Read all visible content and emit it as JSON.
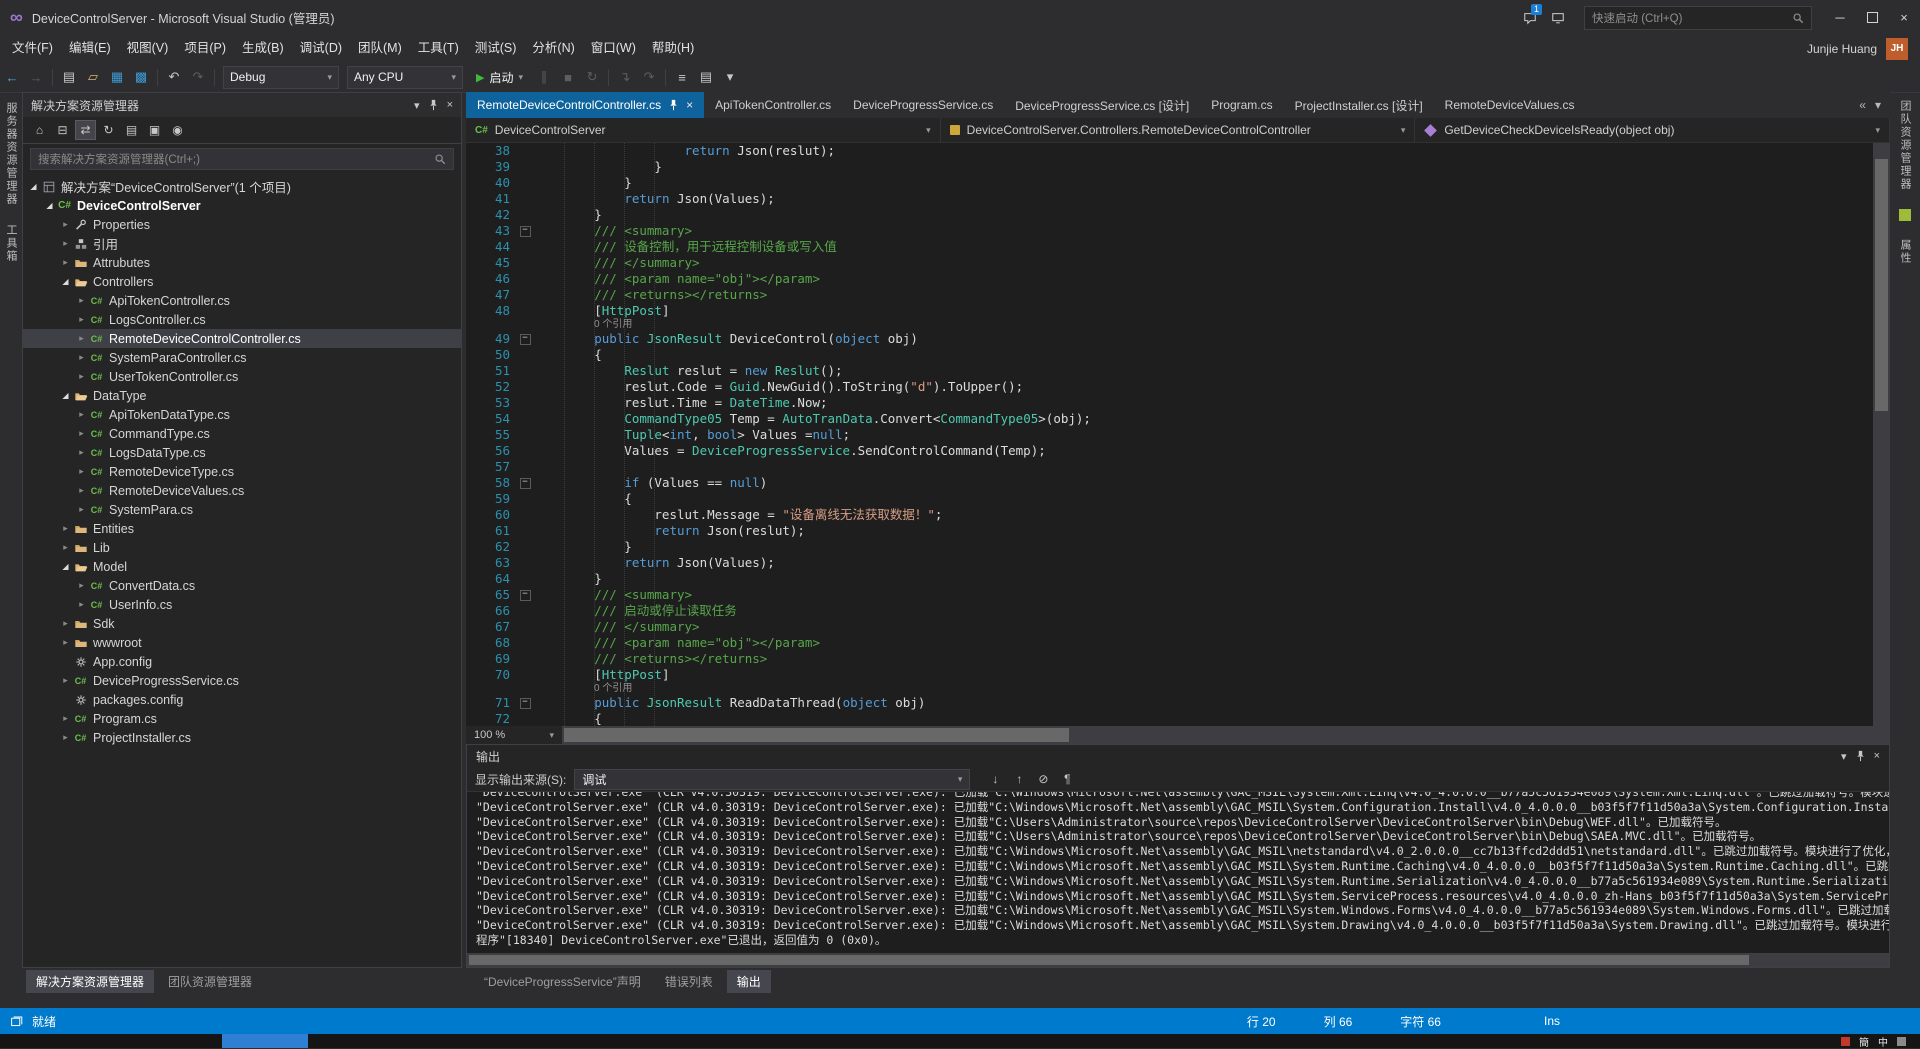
{
  "window": {
    "logo": "∞",
    "title": "DeviceControlServer - Microsoft Visual Studio (管理员)",
    "quick_launch_placeholder": "快速启动 (Ctrl+Q)",
    "feedback_badge": "1",
    "user_name": "Junjie Huang",
    "user_initials": "JH"
  },
  "menu": {
    "items": [
      "文件(F)",
      "编辑(E)",
      "视图(V)",
      "项目(P)",
      "生成(B)",
      "调试(D)",
      "团队(M)",
      "工具(T)",
      "测试(S)",
      "分析(N)",
      "窗口(W)",
      "帮助(H)"
    ]
  },
  "toolbar": {
    "config": "Debug",
    "platform": "Any CPU",
    "start_label": "启动",
    "left_icons": [
      {
        "n": "navigate-backward-icon",
        "g": "←",
        "c": "#4ea6ea"
      },
      {
        "n": "navigate-forward-icon",
        "g": "→",
        "d": 1
      },
      {
        "sep": 1
      },
      {
        "n": "new-file-icon",
        "g": "▤"
      },
      {
        "n": "open-file-icon",
        "g": "▱",
        "c": "#dcb67a"
      },
      {
        "n": "save-icon",
        "g": "▦",
        "c": "#3b99d4"
      },
      {
        "n": "save-all-icon",
        "g": "▩",
        "c": "#3b99d4"
      },
      {
        "sep": 1
      },
      {
        "n": "undo-icon",
        "g": "↶"
      },
      {
        "n": "redo-icon",
        "g": "↷",
        "d": 1
      },
      {
        "sep": 1
      }
    ],
    "right_icons": [
      {
        "n": "break-all-icon",
        "g": "∥",
        "d": 1
      },
      {
        "n": "stop-debugging-icon",
        "g": "■",
        "d": 1
      },
      {
        "n": "restart-icon",
        "g": "↻",
        "d": 1
      },
      {
        "sep": 1
      },
      {
        "n": "step-into-icon",
        "g": "↴",
        "d": 1
      },
      {
        "n": "step-over-icon",
        "g": "↷",
        "d": 1
      },
      {
        "sep": 1
      },
      {
        "n": "find-in-files-icon",
        "g": "≡"
      },
      {
        "n": "comment-icon",
        "g": "▤"
      },
      {
        "n": "toolbar-options-icon",
        "g": "▾"
      }
    ]
  },
  "strips": {
    "left": [
      "服务器资源管理器",
      "工具箱"
    ],
    "right": [
      "团队资源管理器",
      "属性"
    ]
  },
  "solution_explorer": {
    "title": "解决方案资源管理器",
    "search_placeholder": "搜索解决方案资源管理器(Ctrl+;)",
    "header_icons": [
      {
        "n": "window-position-icon",
        "g": "▾"
      },
      {
        "n": "pin-icon",
        "g": "@pin"
      },
      {
        "n": "close-icon",
        "g": "×"
      }
    ],
    "toolbar_icons": [
      {
        "n": "home-icon",
        "g": "⌂"
      },
      {
        "n": "collapse-all-icon",
        "g": "⊟"
      },
      {
        "n": "sync-with-active-document-icon",
        "g": "⇄",
        "pressed": 1
      },
      {
        "n": "refresh-icon",
        "g": "↻"
      },
      {
        "n": "show-all-files-icon",
        "g": "▤"
      },
      {
        "n": "properties-icon",
        "g": "▣"
      },
      {
        "n": "preview-selected-items-icon",
        "g": "◉"
      }
    ],
    "tree": [
      {
        "d": 0,
        "a": 2,
        "i": "sol",
        "t": "解决方案“DeviceControlServer”(1 个项目)"
      },
      {
        "d": 1,
        "a": 2,
        "i": "proj",
        "t": "DeviceControlServer",
        "b": 1
      },
      {
        "d": 2,
        "a": 1,
        "i": "props",
        "t": "Properties"
      },
      {
        "d": 2,
        "a": 1,
        "i": "refs",
        "t": "引用"
      },
      {
        "d": 2,
        "a": 1,
        "i": "folder",
        "t": "Attrubutes"
      },
      {
        "d": 2,
        "a": 2,
        "i": "folderOpen",
        "t": "Controllers"
      },
      {
        "d": 3,
        "a": 1,
        "i": "cs",
        "t": "ApiTokenController.cs"
      },
      {
        "d": 3,
        "a": 1,
        "i": "cs",
        "t": "LogsController.cs"
      },
      {
        "d": 3,
        "a": 1,
        "i": "cs",
        "t": "RemoteDeviceControlController.cs",
        "sel": 1
      },
      {
        "d": 3,
        "a": 1,
        "i": "cs",
        "t": "SystemParaController.cs"
      },
      {
        "d": 3,
        "a": 1,
        "i": "cs",
        "t": "UserTokenController.cs"
      },
      {
        "d": 2,
        "a": 2,
        "i": "folderOpen",
        "t": "DataType"
      },
      {
        "d": 3,
        "a": 1,
        "i": "cs",
        "t": "ApiTokenDataType.cs"
      },
      {
        "d": 3,
        "a": 1,
        "i": "cs",
        "t": "CommandType.cs"
      },
      {
        "d": 3,
        "a": 1,
        "i": "cs",
        "t": "LogsDataType.cs"
      },
      {
        "d": 3,
        "a": 1,
        "i": "cs",
        "t": "RemoteDeviceType.cs"
      },
      {
        "d": 3,
        "a": 1,
        "i": "cs",
        "t": "RemoteDeviceValues.cs"
      },
      {
        "d": 3,
        "a": 1,
        "i": "cs",
        "t": "SystemPara.cs"
      },
      {
        "d": 2,
        "a": 1,
        "i": "folder",
        "t": "Entities"
      },
      {
        "d": 2,
        "a": 1,
        "i": "folder",
        "t": "Lib"
      },
      {
        "d": 2,
        "a": 2,
        "i": "folderOpen",
        "t": "Model"
      },
      {
        "d": 3,
        "a": 1,
        "i": "cs",
        "t": "ConvertData.cs"
      },
      {
        "d": 3,
        "a": 1,
        "i": "cs",
        "t": "UserInfo.cs"
      },
      {
        "d": 2,
        "a": 1,
        "i": "folder",
        "t": "Sdk"
      },
      {
        "d": 2,
        "a": 1,
        "i": "folder",
        "t": "wwwroot"
      },
      {
        "d": 2,
        "a": 0,
        "i": "cfg",
        "t": "App.config"
      },
      {
        "d": 2,
        "a": 1,
        "i": "cs",
        "t": "DeviceProgressService.cs"
      },
      {
        "d": 2,
        "a": 0,
        "i": "cfg",
        "t": "packages.config"
      },
      {
        "d": 2,
        "a": 1,
        "i": "cs",
        "t": "Program.cs"
      },
      {
        "d": 2,
        "a": 1,
        "i": "cs",
        "t": "ProjectInstaller.cs"
      }
    ]
  },
  "editor": {
    "tabs": [
      {
        "t": "RemoteDeviceControlController.cs",
        "active": true
      },
      {
        "t": "ApiTokenController.cs"
      },
      {
        "t": "DeviceProgressService.cs"
      },
      {
        "t": "DeviceProgressService.cs [设计]"
      },
      {
        "t": "Program.cs"
      },
      {
        "t": "ProjectInstaller.cs [设计]"
      },
      {
        "t": "RemoteDeviceValues.cs"
      }
    ],
    "breadcrumb": [
      {
        "t": "DeviceControlServer",
        "icon": "project"
      },
      {
        "t": "DeviceControlServer.Controllers.RemoteDeviceControlController",
        "icon": "class"
      },
      {
        "t": "GetDeviceCheckDeviceIsReady(object obj)",
        "icon": "method"
      }
    ],
    "zoom": "100 %",
    "code": [
      {
        "n": 38,
        "g": [
          [
            "p",
            "                    "
          ],
          [
            "k",
            "return"
          ],
          [
            "p",
            " Json(reslut);"
          ]
        ]
      },
      {
        "n": 39,
        "g": [
          [
            "p",
            "                }"
          ]
        ]
      },
      {
        "n": 40,
        "g": [
          [
            "p",
            "            }"
          ]
        ]
      },
      {
        "n": 41,
        "g": [
          [
            "p",
            "            "
          ],
          [
            "k",
            "return"
          ],
          [
            "p",
            " Json(Values);"
          ]
        ]
      },
      {
        "n": 42,
        "g": [
          [
            "p",
            "        }"
          ]
        ]
      },
      {
        "n": 43,
        "f": 1,
        "g": [
          [
            "c",
            "        /// <summary>"
          ]
        ]
      },
      {
        "n": 44,
        "g": [
          [
            "c",
            "        /// 设备控制，用于远程控制设备或写入值"
          ]
        ]
      },
      {
        "n": 45,
        "g": [
          [
            "c",
            "        /// </summary>"
          ]
        ]
      },
      {
        "n": 46,
        "g": [
          [
            "c",
            "        /// <param name=\"obj\"></param>"
          ]
        ]
      },
      {
        "n": 47,
        "g": [
          [
            "c",
            "        /// <returns></returns>"
          ]
        ]
      },
      {
        "n": 48,
        "g": [
          [
            "p",
            "        ["
          ],
          [
            "t",
            "HttpPost"
          ],
          [
            "p",
            "]"
          ]
        ]
      },
      {
        "l": "0 个引用"
      },
      {
        "n": 49,
        "f": 1,
        "g": [
          [
            "p",
            "        "
          ],
          [
            "k",
            "public"
          ],
          [
            "p",
            " "
          ],
          [
            "t",
            "JsonResult"
          ],
          [
            "p",
            " DeviceControl("
          ],
          [
            "k",
            "object"
          ],
          [
            "p",
            " obj)"
          ]
        ]
      },
      {
        "n": 50,
        "g": [
          [
            "p",
            "        {"
          ]
        ]
      },
      {
        "n": 51,
        "g": [
          [
            "p",
            "            "
          ],
          [
            "t",
            "Reslut"
          ],
          [
            "p",
            " reslut = "
          ],
          [
            "k",
            "new"
          ],
          [
            "p",
            " "
          ],
          [
            "t",
            "Reslut"
          ],
          [
            "p",
            "();"
          ]
        ]
      },
      {
        "n": 52,
        "g": [
          [
            "p",
            "            reslut.Code = "
          ],
          [
            "t",
            "Guid"
          ],
          [
            "p",
            ".NewGuid().ToString("
          ],
          [
            "s",
            "\"d\""
          ],
          [
            "p",
            ").ToUpper();"
          ]
        ]
      },
      {
        "n": 53,
        "g": [
          [
            "p",
            "            reslut.Time = "
          ],
          [
            "t",
            "DateTime"
          ],
          [
            "p",
            ".Now;"
          ]
        ]
      },
      {
        "n": 54,
        "g": [
          [
            "p",
            "            "
          ],
          [
            "t",
            "CommandType05"
          ],
          [
            "p",
            " Temp = "
          ],
          [
            "t",
            "AutoTranData"
          ],
          [
            "p",
            ".Convert<"
          ],
          [
            "t",
            "CommandType05"
          ],
          [
            "p",
            ">(obj);"
          ]
        ]
      },
      {
        "n": 55,
        "g": [
          [
            "p",
            "            "
          ],
          [
            "t",
            "Tuple"
          ],
          [
            "p",
            "<"
          ],
          [
            "k",
            "int"
          ],
          [
            "p",
            ", "
          ],
          [
            "k",
            "bool"
          ],
          [
            "p",
            "> Values ="
          ],
          [
            "k",
            "null"
          ],
          [
            "p",
            ";"
          ]
        ]
      },
      {
        "n": 56,
        "g": [
          [
            "p",
            "            Values = "
          ],
          [
            "t",
            "DeviceProgressService"
          ],
          [
            "p",
            ".SendControlCommand(Temp);"
          ]
        ]
      },
      {
        "n": 57,
        "g": []
      },
      {
        "n": 58,
        "f": 1,
        "g": [
          [
            "p",
            "            "
          ],
          [
            "k",
            "if"
          ],
          [
            "p",
            " (Values == "
          ],
          [
            "k",
            "null"
          ],
          [
            "p",
            ")"
          ]
        ]
      },
      {
        "n": 59,
        "g": [
          [
            "p",
            "            {"
          ]
        ]
      },
      {
        "n": 60,
        "g": [
          [
            "p",
            "                reslut.Message = "
          ],
          [
            "s",
            "\"设备离线无法获取数据！\""
          ],
          [
            "p",
            ";"
          ]
        ]
      },
      {
        "n": 61,
        "g": [
          [
            "p",
            "                "
          ],
          [
            "k",
            "return"
          ],
          [
            "p",
            " Json(reslut);"
          ]
        ]
      },
      {
        "n": 62,
        "g": [
          [
            "p",
            "            }"
          ]
        ]
      },
      {
        "n": 63,
        "g": [
          [
            "p",
            "            "
          ],
          [
            "k",
            "return"
          ],
          [
            "p",
            " Json(Values);"
          ]
        ]
      },
      {
        "n": 64,
        "g": [
          [
            "p",
            "        }"
          ]
        ]
      },
      {
        "n": 65,
        "f": 1,
        "g": [
          [
            "c",
            "        /// <summary>"
          ]
        ]
      },
      {
        "n": 66,
        "g": [
          [
            "c",
            "        /// 启动或停止读取任务"
          ]
        ]
      },
      {
        "n": 67,
        "g": [
          [
            "c",
            "        /// </summary>"
          ]
        ]
      },
      {
        "n": 68,
        "g": [
          [
            "c",
            "        /// <param name=\"obj\"></param>"
          ]
        ]
      },
      {
        "n": 69,
        "g": [
          [
            "c",
            "        /// <returns></returns>"
          ]
        ]
      },
      {
        "n": 70,
        "g": [
          [
            "p",
            "        ["
          ],
          [
            "t",
            "HttpPost"
          ],
          [
            "p",
            "]"
          ]
        ]
      },
      {
        "l": "0 个引用"
      },
      {
        "n": 71,
        "f": 1,
        "g": [
          [
            "p",
            "        "
          ],
          [
            "k",
            "public"
          ],
          [
            "p",
            " "
          ],
          [
            "t",
            "JsonResult"
          ],
          [
            "p",
            " ReadDataThread("
          ],
          [
            "k",
            "object"
          ],
          [
            "p",
            " obj)"
          ]
        ]
      },
      {
        "n": 72,
        "g": [
          [
            "p",
            "        {"
          ]
        ]
      }
    ]
  },
  "output": {
    "title": "输出",
    "source_label": "显示输出来源(S):",
    "source_value": "调试",
    "header_icons": [
      {
        "n": "window-position-icon",
        "g": "▾"
      },
      {
        "n": "pin-icon",
        "g": "@pin"
      },
      {
        "n": "close-icon",
        "g": "×"
      }
    ],
    "toolbar_icons": [
      {
        "n": "next-message-icon",
        "g": "↓"
      },
      {
        "n": "previous-message-icon",
        "g": "↑"
      },
      {
        "n": "clear-all-icon",
        "g": "⊘"
      },
      {
        "n": "word-wrap-icon",
        "g": "¶"
      }
    ],
    "lines": [
      "\"DeviceControlServer.exe\" (CLR v4.0.30319: DeviceControlServer.exe): 已加载\"C:\\Windows\\Microsoft.Net\\assembly\\GAC_MSIL\\System.Xml.Linq\\v4.0_4.0.0.0__b77a5c561934e089\\System.Xml.Linq.dll\"。已跳过加载符号。模块进行了优化，并且调试器选项\"仅我的代码\"已启用。",
      "\"DeviceControlServer.exe\" (CLR v4.0.30319: DeviceControlServer.exe): 已加载\"C:\\Windows\\Microsoft.Net\\assembly\\GAC_MSIL\\System.Configuration.Install\\v4.0_4.0.0.0__b03f5f7f11d50a3a\\System.Configuration.Install.dll\"。已跳过加载符号。",
      "\"DeviceControlServer.exe\" (CLR v4.0.30319: DeviceControlServer.exe): 已加载\"C:\\Users\\Administrator\\source\\repos\\DeviceControlServer\\DeviceControlServer\\bin\\Debug\\WEF.dll\"。已加载符号。",
      "\"DeviceControlServer.exe\" (CLR v4.0.30319: DeviceControlServer.exe): 已加载\"C:\\Users\\Administrator\\source\\repos\\DeviceControlServer\\DeviceControlServer\\bin\\Debug\\SAEA.MVC.dll\"。已加载符号。",
      "\"DeviceControlServer.exe\" (CLR v4.0.30319: DeviceControlServer.exe): 已加载\"C:\\Windows\\Microsoft.Net\\assembly\\GAC_MSIL\\netstandard\\v4.0_2.0.0.0__cc7b13ffcd2ddd51\\netstandard.dll\"。已跳过加载符号。模块进行了优化，并且调试器选项\"仅我的代码\"已启用。",
      "\"DeviceControlServer.exe\" (CLR v4.0.30319: DeviceControlServer.exe): 已加载\"C:\\Windows\\Microsoft.Net\\assembly\\GAC_MSIL\\System.Runtime.Caching\\v4.0_4.0.0.0__b03f5f7f11d50a3a\\System.Runtime.Caching.dll\"。已跳过加载符号。模块进行了优化，并且调试器选项\"仅我的代码\"已启用。",
      "\"DeviceControlServer.exe\" (CLR v4.0.30319: DeviceControlServer.exe): 已加载\"C:\\Windows\\Microsoft.Net\\assembly\\GAC_MSIL\\System.Runtime.Serialization\\v4.0_4.0.0.0__b77a5c561934e089\\System.Runtime.Serialization.dll\"。已跳过加载符号。模块进行了优化，并且调试器选项\"仅我的代码\"已启用。",
      "\"DeviceControlServer.exe\" (CLR v4.0.30319: DeviceControlServer.exe): 已加载\"C:\\Windows\\Microsoft.Net\\assembly\\GAC_MSIL\\System.ServiceProcess.resources\\v4.0_4.0.0.0_zh-Hans_b03f5f7f11d50a3a\\System.ServiceProcess.resources.dll\"。模块已生成，不包含符号。",
      "\"DeviceControlServer.exe\" (CLR v4.0.30319: DeviceControlServer.exe): 已加载\"C:\\Windows\\Microsoft.Net\\assembly\\GAC_MSIL\\System.Windows.Forms\\v4.0_4.0.0.0__b77a5c561934e089\\System.Windows.Forms.dll\"。已跳过加载符号。模块进行了优化，并且调试器选项\"仅我的代码\"已启用。",
      "\"DeviceControlServer.exe\" (CLR v4.0.30319: DeviceControlServer.exe): 已加载\"C:\\Windows\\Microsoft.Net\\assembly\\GAC_MSIL\\System.Drawing\\v4.0_4.0.0.0__b03f5f7f11d50a3a\\System.Drawing.dll\"。已跳过加载符号。模块进行了优化，并且调试器选项\"仅我的代码\"已启用。",
      "程序\"[18340] DeviceControlServer.exe\"已退出，返回值为 0 (0x0)。"
    ]
  },
  "bottom_tabs": {
    "left": [
      {
        "t": "解决方案资源管理器",
        "active": true
      },
      {
        "t": "团队资源管理器"
      }
    ],
    "panel": [
      {
        "t": "“DeviceProgressService”声明"
      },
      {
        "t": "错误列表"
      },
      {
        "t": "输出",
        "active": true
      }
    ]
  },
  "status": {
    "message": "就绪",
    "line": "行 20",
    "column": "列 66",
    "character": "字符 66",
    "mode": "Ins"
  },
  "taskbar": {
    "items": [
      {
        "n": "taskbar-notification-icon",
        "c": "#c0392b"
      },
      {
        "n": "ime-simplified-icon",
        "g": "簡"
      },
      {
        "n": "ime-chinese-mode-icon",
        "g": "中"
      },
      {
        "n": "taskbar-tray-icon",
        "c": "#8a8a8a"
      }
    ]
  },
  "colors": {
    "accent": "#007acc",
    "active_tab": "#0e639c",
    "keyword": "#569cd6",
    "type": "#4ec9b0",
    "string": "#d69d85",
    "comment": "#57a64a",
    "line_number": "#2b91af",
    "folder": "#dcb67a"
  }
}
